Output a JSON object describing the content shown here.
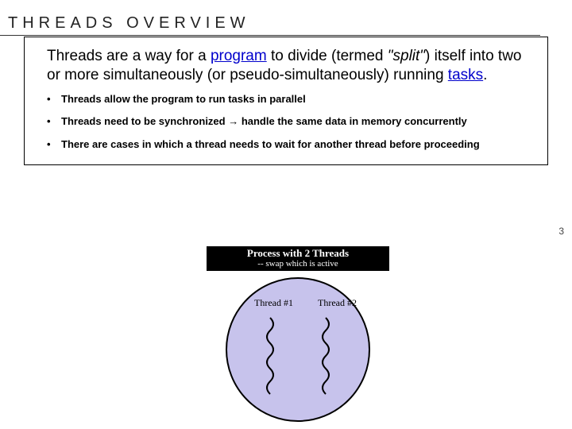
{
  "title": "THREADS OVERVIEW",
  "intro": {
    "pre": " Threads are a way for a ",
    "link1": "program",
    "mid1": " to divide (termed ",
    "italic": "\"split\"",
    "mid2": ") itself into two or more simultaneously (or pseudo-simultaneously) running ",
    "link2": "tasks",
    "end": "."
  },
  "bullets": [
    "Threads allow the program to run tasks in parallel",
    "Threads need to be synchronized →  handle the same data in memory concurrently",
    "There are cases in which a thread needs to wait for another thread before proceeding"
  ],
  "pageNumber": "3",
  "diagram": {
    "title": "Process with 2 Threads",
    "subtitle": "-- swap which is active",
    "thread1": "Thread #1",
    "thread2": "Thread #2"
  }
}
